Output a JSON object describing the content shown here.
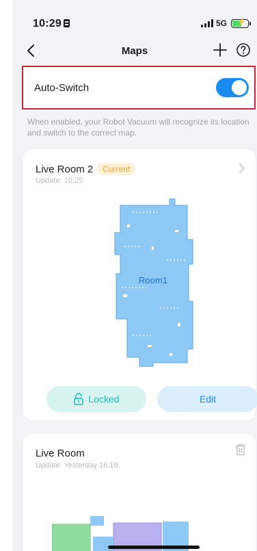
{
  "status": {
    "time": "10:29",
    "network": "5G"
  },
  "nav": {
    "title": "Maps"
  },
  "auto_switch": {
    "label": "Auto-Switch",
    "enabled": true,
    "hint": "When enabled, your Robot Vacuum will recognize its location and switch to the correct map."
  },
  "maps": [
    {
      "name": "Live Room 2",
      "badge": "Current",
      "updated": "Update: 10:25",
      "room_label": "Room1",
      "locked_label": "Locked",
      "edit_label": "Edit"
    },
    {
      "name": "Live Room",
      "updated": "Update: Yesterday 16:19"
    }
  ],
  "colors": {
    "accent": "#1a8cf0",
    "highlight_border": "#c8273a",
    "badge_text": "#f5a623",
    "map_fill": "#8ec9f5",
    "locked": "#18bfae"
  },
  "icons": [
    "back-icon",
    "add-icon",
    "help-icon",
    "chevron-right-icon",
    "lock-icon",
    "trash-icon"
  ]
}
